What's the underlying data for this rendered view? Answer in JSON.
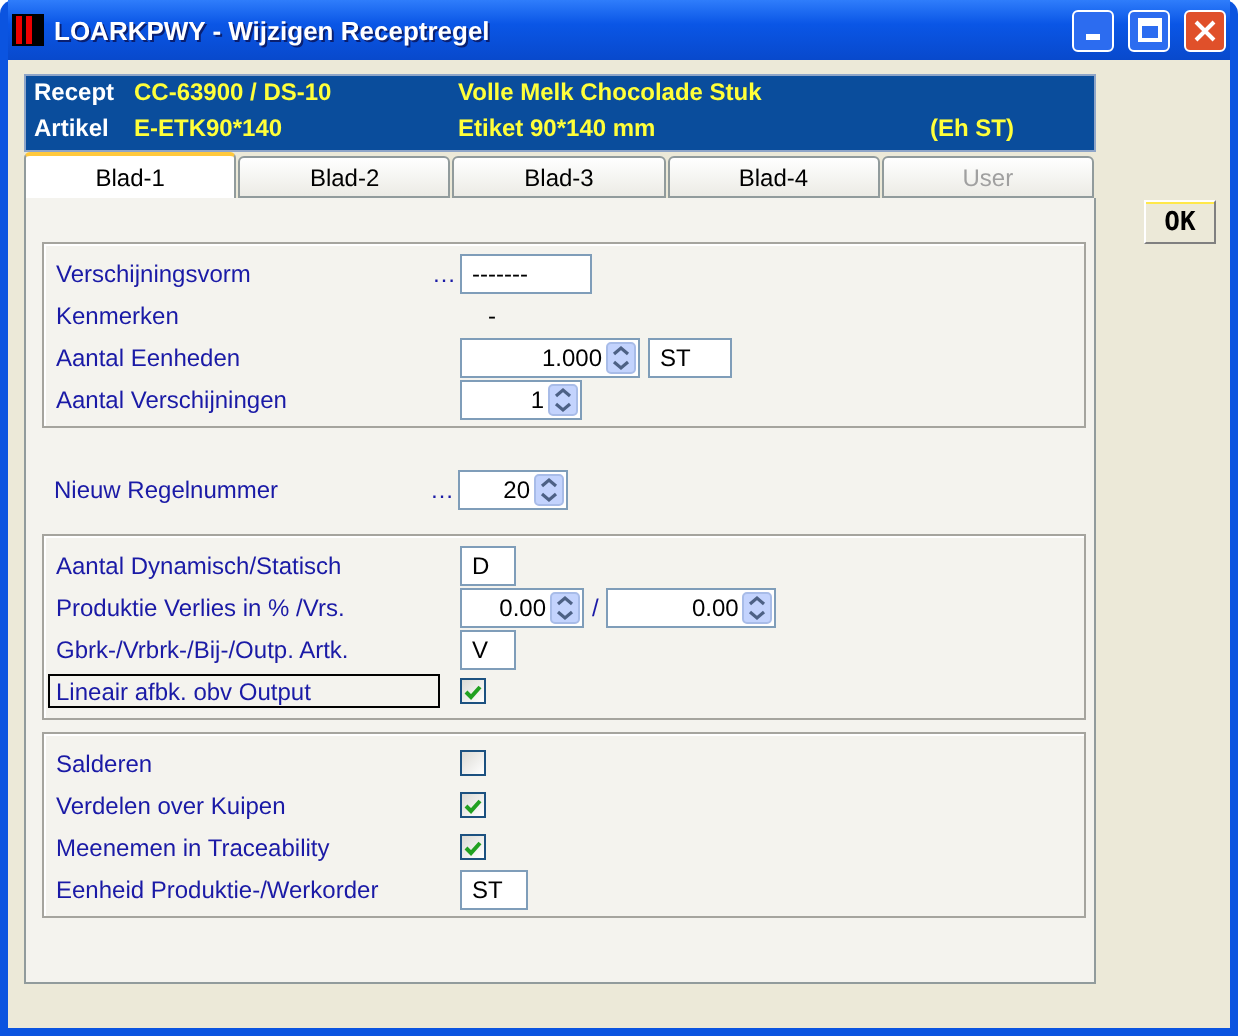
{
  "window": {
    "title": "LOARKPWY - Wijzigen Receptregel"
  },
  "header": [
    {
      "label": "Recept",
      "code": "CC-63900 / DS-10",
      "description": "Volle Melk Chocolade Stuk"
    },
    {
      "label": "Artikel",
      "code": "E-ETK90*140",
      "description": "Etiket 90*140 mm",
      "unit": "(Eh ST)"
    }
  ],
  "tabs": [
    {
      "label": "Blad-1",
      "selected": true,
      "disabled": false
    },
    {
      "label": "Blad-2",
      "selected": false,
      "disabled": false
    },
    {
      "label": "Blad-3",
      "selected": false,
      "disabled": false
    },
    {
      "label": "Blad-4",
      "selected": false,
      "disabled": false
    },
    {
      "label": "User",
      "selected": false,
      "disabled": true
    }
  ],
  "ok_button": "OK",
  "sections": [
    {
      "framed": true,
      "rows": [
        {
          "kind": "text",
          "label": "Verschijningsvorm",
          "lookup": "…",
          "value": "-------"
        },
        {
          "kind": "plain",
          "label": "Kenmerken",
          "value": "-"
        },
        {
          "kind": "spin-unit",
          "label": "Aantal Eenheden",
          "value": "1.000",
          "unit": "ST"
        },
        {
          "kind": "spin",
          "label": "Aantal Verschijningen",
          "value": "1"
        }
      ]
    },
    {
      "framed": false,
      "rows": [
        {
          "kind": "spin",
          "label": "Nieuw Regelnummer",
          "lookup": "…",
          "value": "20"
        }
      ]
    },
    {
      "framed": true,
      "rows": [
        {
          "kind": "text",
          "label": "Aantal Dynamisch/Statisch",
          "value": "D"
        },
        {
          "kind": "spin-pair",
          "label": "Produktie Verlies in % /Vrs.",
          "value": "0.00",
          "separator": "/",
          "value2": "0.00"
        },
        {
          "kind": "text",
          "label": "Gbrk-/Vrbrk-/Bij-/Outp. Artk.",
          "value": "V"
        },
        {
          "kind": "checkbox",
          "label": "Lineair afbk. obv Output",
          "checked": true,
          "focused": true
        }
      ]
    },
    {
      "framed": true,
      "rows": [
        {
          "kind": "checkbox",
          "label": "Salderen",
          "checked": false
        },
        {
          "kind": "checkbox",
          "label": "Verdelen over Kuipen",
          "checked": true
        },
        {
          "kind": "checkbox",
          "label": "Meenemen in Traceability",
          "checked": true
        },
        {
          "kind": "text",
          "label": "Eenheid Produktie-/Werkorder",
          "value": "ST"
        }
      ]
    }
  ]
}
